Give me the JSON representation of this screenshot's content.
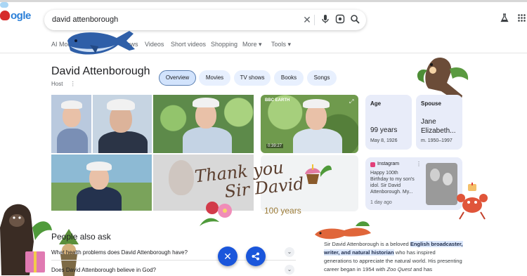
{
  "logo": {
    "text": "ogle"
  },
  "search": {
    "query": "david attenborough"
  },
  "tabs": [
    "AI Mode",
    "News",
    "Videos",
    "Short videos",
    "Shopping",
    "More ▾",
    "Tools ▾"
  ],
  "entity": {
    "title": "David Attenborough",
    "subtitle": "Host"
  },
  "chips": [
    "Overview",
    "Movies",
    "TV shows",
    "Books",
    "Songs"
  ],
  "video": {
    "source": "BBC EARTH",
    "duration": "0:39:27"
  },
  "age_card": {
    "label": "Age",
    "value": "99 years",
    "detail": "May 8, 1926"
  },
  "spouse_card": {
    "label": "Spouse",
    "value_line1": "Jane",
    "value_line2": "Elizabeth...",
    "detail": "m. 1950–1997"
  },
  "instagram_card": {
    "source": "Instagram",
    "text_lines": [
      "Happy 100th",
      "Birthday to my son's",
      "idol. Sir David",
      "Attenborough. My..."
    ],
    "time": "1 day ago"
  },
  "overlay": {
    "line1": "Thank you",
    "line2": "Sir David",
    "years": "100 years"
  },
  "paa": {
    "title": "People also ask",
    "questions": [
      "What health problems does David Attenborough have?",
      "Does David Attenborough believe in God?"
    ]
  },
  "description": {
    "lead": "Sir David Attenborough is a beloved ",
    "highlight": "English broadcaster, writer, and natural historian",
    "mid": " who has inspired generations to appreciate the natural world. His presenting career began in 1954 with ",
    "italic": "Zoo Quest",
    "tail": " and has"
  },
  "colors": {
    "accent": "#1a56db",
    "chip": "#e8f0fe",
    "card": "#e8ecf9"
  }
}
